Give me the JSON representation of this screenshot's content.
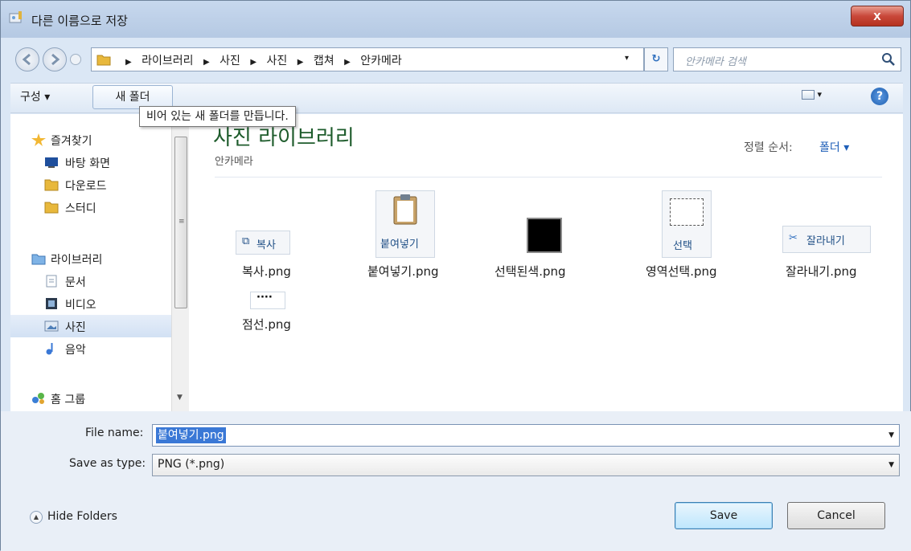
{
  "window": {
    "title": "다른 이름으로 저장",
    "close_label": "x"
  },
  "address": {
    "crumbs": [
      "라이브러리",
      "사진",
      "사진",
      "캡쳐",
      "안카메라"
    ],
    "dropdown_glyph": "▾",
    "refresh_glyph": "↻"
  },
  "search": {
    "placeholder": "안카메라 검색"
  },
  "toolbar": {
    "organize_label": "구성 ▾",
    "new_folder_label": "새 폴더",
    "views_glyph": "▾",
    "help_label": "?"
  },
  "tooltip": {
    "text": "비어 있는 새 폴더를 만듭니다."
  },
  "nav": {
    "items": [
      {
        "label": "즐겨찾기",
        "icon": "star-icon"
      },
      {
        "label": "바탕 화면",
        "icon": "desktop-icon"
      },
      {
        "label": "다운로드",
        "icon": "folder-icon"
      },
      {
        "label": "스터디",
        "icon": "folder-icon"
      },
      {
        "label": "라이브러리",
        "icon": "library-icon"
      },
      {
        "label": "문서",
        "icon": "document-icon"
      },
      {
        "label": "비디오",
        "icon": "video-icon"
      },
      {
        "label": "사진",
        "icon": "picture-icon"
      },
      {
        "label": "음악",
        "icon": "music-icon"
      },
      {
        "label": "홈 그룹",
        "icon": "homegroup-icon"
      }
    ],
    "selected": "사진",
    "scroll_grip": "≡",
    "scroll_down": "▼"
  },
  "content": {
    "library_title": "사진 라이브러리",
    "subtitle": "안카메라",
    "sort_label": "정렬 순서:",
    "sort_value": "폴더 ▾",
    "files": [
      {
        "name": "복사.png",
        "thumb_text": "복사"
      },
      {
        "name": "붙여넣기.png",
        "thumb_text": "붙여넣기"
      },
      {
        "name": "선택된색.png",
        "thumb_text": ""
      },
      {
        "name": "영역선택.png",
        "thumb_text": "선택"
      },
      {
        "name": "잘라내기.png",
        "thumb_text": "잘라내기"
      },
      {
        "name": "점선.png",
        "thumb_text": "····"
      }
    ]
  },
  "form": {
    "file_name_label": "File name:",
    "file_name_value": "붙여넣기.png",
    "save_type_label": "Save as type:",
    "save_type_value": "PNG (*.png)",
    "arrow_glyph": "▼"
  },
  "footer": {
    "hide_folders_label": "Hide Folders",
    "hide_icon_glyph": "▲",
    "save_label": "Save",
    "cancel_label": "Cancel"
  },
  "colors": {
    "accent": "#1f5fb8",
    "library_title": "#1e5c2c",
    "selection": "#3a78d6"
  }
}
